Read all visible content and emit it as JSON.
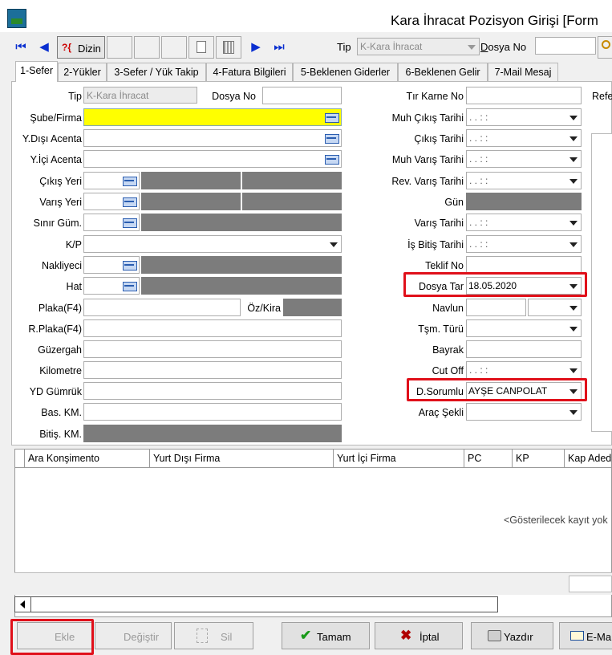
{
  "window": {
    "title": "Kara İhracat Pozisyon Girişi [Form"
  },
  "toolbar": {
    "dizin_label": "Dizin",
    "tip_label": "Tip",
    "tip_value": "K-Kara İhracat",
    "dosya_no_label": "Dosya No",
    "dosya_no_value": ""
  },
  "tabs": [
    {
      "label": "1-Sefer"
    },
    {
      "label": "2-Yükler"
    },
    {
      "label": "3-Sefer / Yük Takip"
    },
    {
      "label": "4-Fatura Bilgileri"
    },
    {
      "label": "5-Beklenen Giderler"
    },
    {
      "label": "6-Beklenen Gelir"
    },
    {
      "label": "7-Mail Mesaj"
    }
  ],
  "left": {
    "tip_label": "Tip",
    "tip_value": "K-Kara İhracat",
    "dosya_no_label": "Dosya No",
    "sube_label": "Şube/Firma",
    "ydisi_label": "Y.Dışı Acenta",
    "yici_label": "Y.İçi Acenta",
    "cikis_yeri_label": "Çıkış Yeri",
    "varis_yeri_label": "Varış Yeri",
    "sinir_gum_label": "Sınır Güm.",
    "kp_label": "K/P",
    "nakliyeci_label": "Nakliyeci",
    "hat_label": "Hat",
    "plaka_label": "Plaka(F4)",
    "oz_kira_label": "Öz/Kira",
    "rplaka_label": "R.Plaka(F4)",
    "guzergah_label": "Güzergah",
    "kilometre_label": "Kilometre",
    "yd_gumruk_label": "YD Gümrük",
    "bas_km_label": "Bas. KM.",
    "bitis_km_label": "Bitiş. KM."
  },
  "right": {
    "tir_karne_label": "Tır Karne No",
    "muh_cikis_label": "Muh Çıkış Tarihi",
    "cikis_tarihi_label": "Çıkış Tarihi",
    "muh_varis_label": "Muh Varış Tarihi",
    "rev_varis_label": "Rev. Varış Tarihi",
    "gun_label": "Gün",
    "varis_tarihi_label": "Varış Tarihi",
    "is_bitis_label": "İş Bitiş Tarihi",
    "teklif_no_label": "Teklif No",
    "dosya_tar_label": "Dosya Tar",
    "dosya_tar_value": "18.05.2020",
    "navlun_label": "Navlun",
    "tsm_turu_label": "Tşm. Türü",
    "bayrak_label": "Bayrak",
    "cut_off_label": "Cut Off",
    "d_sorumlu_label": "D.Sorumlu",
    "d_sorumlu_value": "AYŞE CANPOLAT",
    "arac_sekli_label": "Araç Şekli",
    "date_placeholder": ". .    : :",
    "refe_label": "Refe"
  },
  "grid": {
    "columns": [
      "Ara Konşimento",
      "Yurt Dışı Firma",
      "Yurt İçi Firma",
      "PC",
      "KP",
      "Kap Aded"
    ],
    "empty_message": "<Gösterilecek kayıt yok"
  },
  "buttons": {
    "ekle": "Ekle",
    "degistir": "Değiştir",
    "sil": "Sil",
    "tamam": "Tamam",
    "iptal": "İptal",
    "yazdir": "Yazdır",
    "email": "E-Ma"
  },
  "colors": {
    "highlight": "#e0101a",
    "required_field": "#ffff00",
    "readonly_field": "#7c7c7c"
  }
}
